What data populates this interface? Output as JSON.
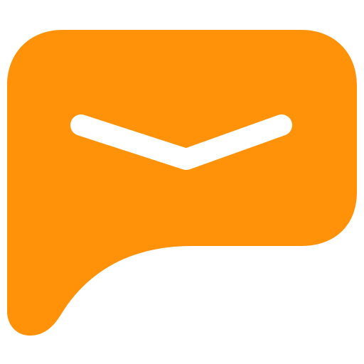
{
  "app_icon": {
    "name": "message-bubble-icon",
    "colors": {
      "background": "#FFFFFF",
      "bubble": "#FF9209",
      "glyph": "#FFFFFF"
    }
  }
}
